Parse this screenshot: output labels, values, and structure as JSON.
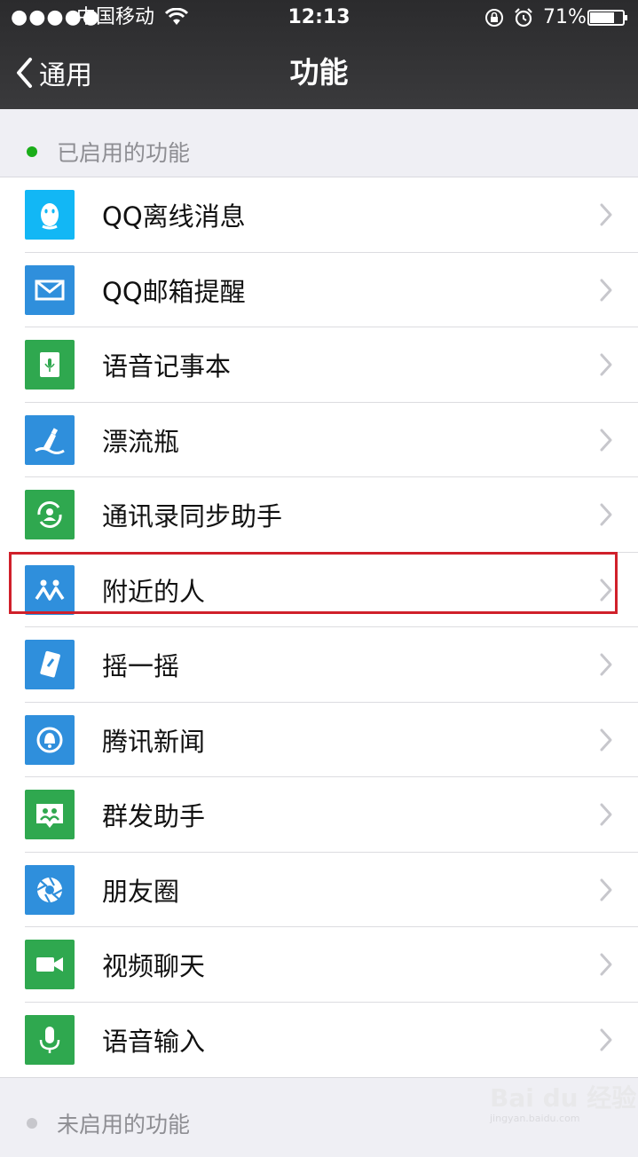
{
  "status_bar": {
    "signal": "●●●●●",
    "carrier": "中国移动",
    "time": "12:13",
    "battery": "71%"
  },
  "nav": {
    "back_label": "通用",
    "title": "功能"
  },
  "enabled_section": {
    "label": "已启用的功能",
    "dot_color": "#1aad19"
  },
  "items": [
    {
      "label": "QQ离线消息",
      "icon": "qq-penguin-icon",
      "color": "#12b7f5"
    },
    {
      "label": "QQ邮箱提醒",
      "icon": "mail-icon",
      "color": "#2f8fdc"
    },
    {
      "label": "语音记事本",
      "icon": "voice-notebook-icon",
      "color": "#2fa84f"
    },
    {
      "label": "漂流瓶",
      "icon": "drift-bottle-icon",
      "color": "#2f8fdc"
    },
    {
      "label": "通讯录同步助手",
      "icon": "contact-sync-icon",
      "color": "#2fa84f"
    },
    {
      "label": "附近的人",
      "icon": "people-nearby-icon",
      "color": "#2f8fdc"
    },
    {
      "label": "摇一摇",
      "icon": "shake-phone-icon",
      "color": "#2f8fdc"
    },
    {
      "label": "腾讯新闻",
      "icon": "tencent-news-icon",
      "color": "#2f8fdc"
    },
    {
      "label": "群发助手",
      "icon": "broadcast-icon",
      "color": "#2fa84f"
    },
    {
      "label": "朋友圈",
      "icon": "moments-icon",
      "color": "#2f8fdc"
    },
    {
      "label": "视频聊天",
      "icon": "video-camera-icon",
      "color": "#2fa84f"
    },
    {
      "label": "语音输入",
      "icon": "microphone-icon",
      "color": "#2fa84f"
    }
  ],
  "disabled_section": {
    "label": "未启用的功能",
    "dot_color": "#c7c7cc"
  },
  "watermark": {
    "text": "Bai du 经验",
    "sub": "jingyan.baidu.com"
  }
}
